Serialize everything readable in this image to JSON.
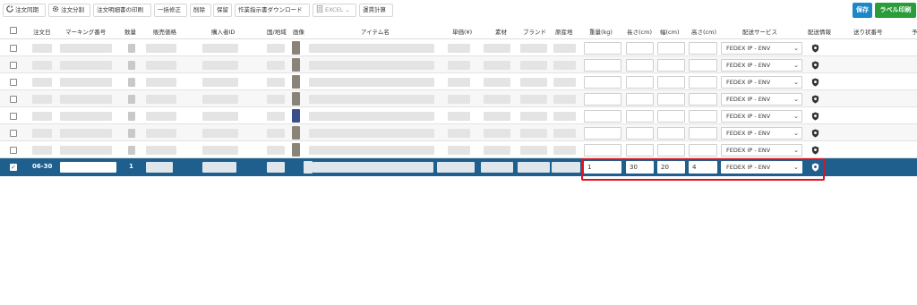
{
  "toolbar": {
    "buttons": [
      {
        "label": "注文同期",
        "icon": "sync-icon"
      },
      {
        "label": "注文分割",
        "icon": "gear-icon"
      },
      {
        "label": "注文明細書の印刷",
        "icon": ""
      },
      {
        "label": "一括修正",
        "icon": ""
      },
      {
        "label": "削除",
        "icon": ""
      },
      {
        "label": "保留",
        "icon": ""
      },
      {
        "label": "作業指示書ダウンロード",
        "icon": ""
      },
      {
        "label": "EXCEL",
        "icon": "excel-icon"
      },
      {
        "label": "運賃計算",
        "icon": ""
      }
    ],
    "save_label": "保存",
    "label_print_label": "ラベル印刷"
  },
  "table": {
    "headers": {
      "order_date": "注文日",
      "marking_no": "マーキング番号",
      "quantity": "数量",
      "sale_price": "販売価格",
      "buyer_id": "購入者ID",
      "country": "国/地域",
      "image": "画像",
      "item_name": "アイテム名",
      "unit_price": "単価(¥)",
      "material": "素材",
      "brand": "ブランド",
      "origin": "原産地",
      "weight": "重量(kg)",
      "length": "長さ(cm)",
      "width": "幅(cm)",
      "height": "高さ(cm)",
      "shipping_service": "配送サービス",
      "shipping_info": "配送情報",
      "tracking_no": "送り状番号",
      "extra": "予"
    },
    "shipping_option": "FEDEX IP - ENV",
    "selected_row": {
      "order_date": "06-30",
      "quantity": "1",
      "weight": "1",
      "length": "30",
      "width": "20",
      "height": "4",
      "shipping_service": "FEDEX IP - ENV",
      "checked_mark": "✓"
    }
  },
  "colors": {
    "selected_row": "#1e5f8e",
    "save_button": "#1c87c9",
    "label_print_button": "#2a9d3a",
    "highlight": "#e3131c"
  }
}
